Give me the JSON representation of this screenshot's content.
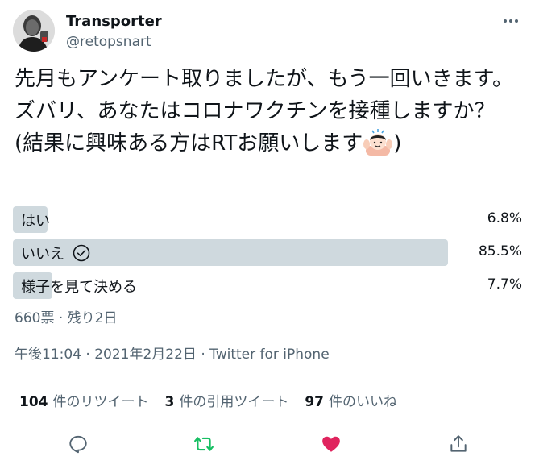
{
  "user": {
    "display_name": "Transporter",
    "handle": "@retopsnart"
  },
  "tweet": {
    "text": "先月もアンケート取りましたが、もう一回いきます。ズバリ、あなたはコロナワクチンを接種しますか？(結果に興味ある方はRTお願いします",
    "text_end": ")"
  },
  "poll": {
    "choices": [
      {
        "label": "はい",
        "percent_label": "6.8%",
        "percent": 6.8,
        "winner": false
      },
      {
        "label": "いいえ",
        "percent_label": "85.5%",
        "percent": 85.5,
        "winner": true
      },
      {
        "label": "様子を見て決める",
        "percent_label": "7.7%",
        "percent": 7.7,
        "winner": false
      }
    ],
    "meta": "660票 · 残り2日"
  },
  "timestamp": "午後11:04 · 2021年2月22日 · Twitter for iPhone",
  "stats": {
    "retweets": {
      "count": "104",
      "label": "件のリツイート"
    },
    "quotes": {
      "count": "3",
      "label": "件の引用ツイート"
    },
    "likes": {
      "count": "97",
      "label": "件のいいね"
    }
  },
  "colors": {
    "retweet_active": "#17bf63",
    "like_active": "#e0245e",
    "muted": "#536471",
    "poll_bar": "#cfd9de"
  },
  "icons": {
    "reply": "reply-icon",
    "retweet": "retweet-icon",
    "like": "like-icon",
    "share": "share-icon",
    "more": "more-icon",
    "check": "check-circle-icon",
    "emoji": "person-raising-hands-emoji"
  }
}
